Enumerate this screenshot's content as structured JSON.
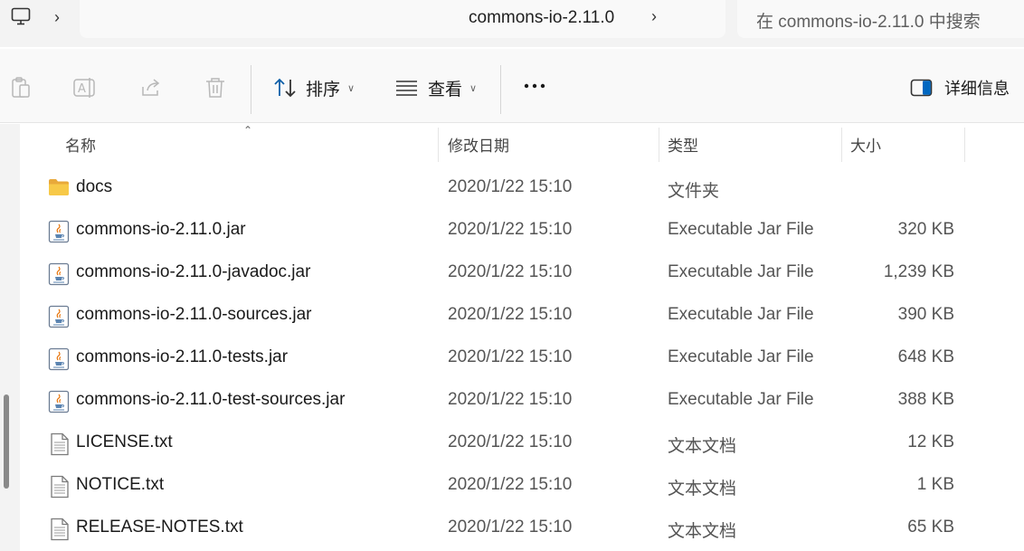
{
  "address": {
    "path_segment": "commons-io-2.11.0",
    "search_placeholder": "在 commons-io-2.11.0 中搜索"
  },
  "toolbar": {
    "sort_label": "排序",
    "view_label": "查看",
    "details_label": "详细信息"
  },
  "columns": {
    "name": "名称",
    "date": "修改日期",
    "type": "类型",
    "size": "大小"
  },
  "files": [
    {
      "name": "docs",
      "date": "2020/1/22 15:10",
      "type": "文件夹",
      "size": "",
      "icon": "folder-icon"
    },
    {
      "name": "commons-io-2.11.0.jar",
      "date": "2020/1/22 15:10",
      "type": "Executable Jar File",
      "size": "320 KB",
      "icon": "jar-file-icon"
    },
    {
      "name": "commons-io-2.11.0-javadoc.jar",
      "date": "2020/1/22 15:10",
      "type": "Executable Jar File",
      "size": "1,239 KB",
      "icon": "jar-file-icon"
    },
    {
      "name": "commons-io-2.11.0-sources.jar",
      "date": "2020/1/22 15:10",
      "type": "Executable Jar File",
      "size": "390 KB",
      "icon": "jar-file-icon"
    },
    {
      "name": "commons-io-2.11.0-tests.jar",
      "date": "2020/1/22 15:10",
      "type": "Executable Jar File",
      "size": "648 KB",
      "icon": "jar-file-icon"
    },
    {
      "name": "commons-io-2.11.0-test-sources.jar",
      "date": "2020/1/22 15:10",
      "type": "Executable Jar File",
      "size": "388 KB",
      "icon": "jar-file-icon"
    },
    {
      "name": "LICENSE.txt",
      "date": "2020/1/22 15:10",
      "type": "文本文档",
      "size": "12 KB",
      "icon": "text-file-icon"
    },
    {
      "name": "NOTICE.txt",
      "date": "2020/1/22 15:10",
      "type": "文本文档",
      "size": "1 KB",
      "icon": "text-file-icon"
    },
    {
      "name": "RELEASE-NOTES.txt",
      "date": "2020/1/22 15:10",
      "type": "文本文档",
      "size": "65 KB",
      "icon": "text-file-icon"
    }
  ],
  "colors": {
    "folder": "#f7c948",
    "accent": "#0067c0",
    "chrome": "#f3f3f3"
  }
}
